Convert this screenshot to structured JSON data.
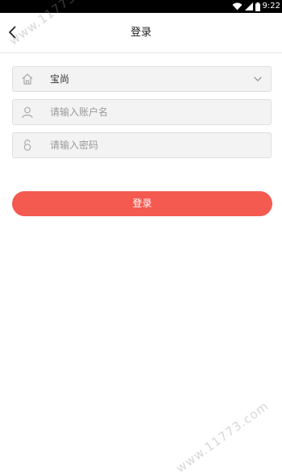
{
  "status_bar": {
    "time": "9:22",
    "icons": [
      "wifi-icon",
      "signal-icon",
      "battery-icon"
    ]
  },
  "header": {
    "title": "登录",
    "back_icon": "chevron-left-icon"
  },
  "form": {
    "store_select": {
      "value": "宝尚",
      "icon": "home-icon",
      "arrow_icon": "chevron-down-icon"
    },
    "username": {
      "placeholder": "请输入账户名",
      "icon": "user-icon"
    },
    "password": {
      "placeholder": "请输入密码",
      "icon": "lock-icon"
    }
  },
  "login_button": {
    "label": "登录"
  },
  "watermark": {
    "text": "www.11773.com"
  },
  "colors": {
    "accent": "#f45a50",
    "field_bg": "#f3f3f3",
    "field_border": "#dfdfdf"
  }
}
